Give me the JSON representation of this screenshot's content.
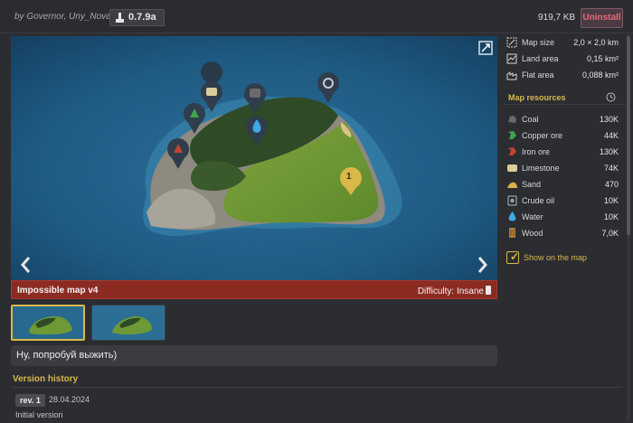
{
  "header": {
    "author": "by Governor, Uny_Novator",
    "version": "0.7.9a",
    "size": "919,7 KB",
    "uninstall_label": "Uninstall"
  },
  "preview": {
    "map_title": "Impossible map v4",
    "difficulty": "Difficulty: Insane",
    "marker_number": "1",
    "icons": [
      "expand-icon",
      "prev-arrow-icon",
      "next-arrow-icon"
    ]
  },
  "description": "Ну, попробуй выжить)",
  "version_history": {
    "title": "Version history",
    "entries": [
      {
        "rev": "rev. 1",
        "date": "28.04.2024",
        "note": "Initial version"
      }
    ]
  },
  "map_info": [
    {
      "label": "Map size",
      "value": "2,0 × 2,0 km",
      "icon": "map-size-icon"
    },
    {
      "label": "Land area",
      "value": "0,15 km²",
      "icon": "land-area-icon"
    },
    {
      "label": "Flat area",
      "value": "0,088 km²",
      "icon": "flat-area-icon"
    }
  ],
  "resources": {
    "title": "Map resources",
    "items": [
      {
        "label": "Coal",
        "value": "130K",
        "icon": "coal-icon",
        "color": "#6b6b6b"
      },
      {
        "label": "Copper ore",
        "value": "44K",
        "icon": "copper-ore-icon",
        "color": "#3fa34d"
      },
      {
        "label": "Iron ore",
        "value": "130K",
        "icon": "iron-ore-icon",
        "color": "#c0452f"
      },
      {
        "label": "Limestone",
        "value": "74K",
        "icon": "limestone-icon",
        "color": "#d8cf9a"
      },
      {
        "label": "Sand",
        "value": "470",
        "icon": "sand-icon",
        "color": "#d9b24a"
      },
      {
        "label": "Crude oil",
        "value": "10K",
        "icon": "crude-oil-icon",
        "color": "#9aa4b0"
      },
      {
        "label": "Water",
        "value": "10K",
        "icon": "water-icon",
        "color": "#3fa8e6"
      },
      {
        "label": "Wood",
        "value": "7,0K",
        "icon": "wood-icon",
        "color": "#b07a3a"
      }
    ]
  },
  "show_on_map": {
    "label": "Show on the map",
    "checked": true
  },
  "colors": {
    "accent": "#d9b84a",
    "danger": "#e66a7a",
    "title_strip": "#8c2b22"
  }
}
